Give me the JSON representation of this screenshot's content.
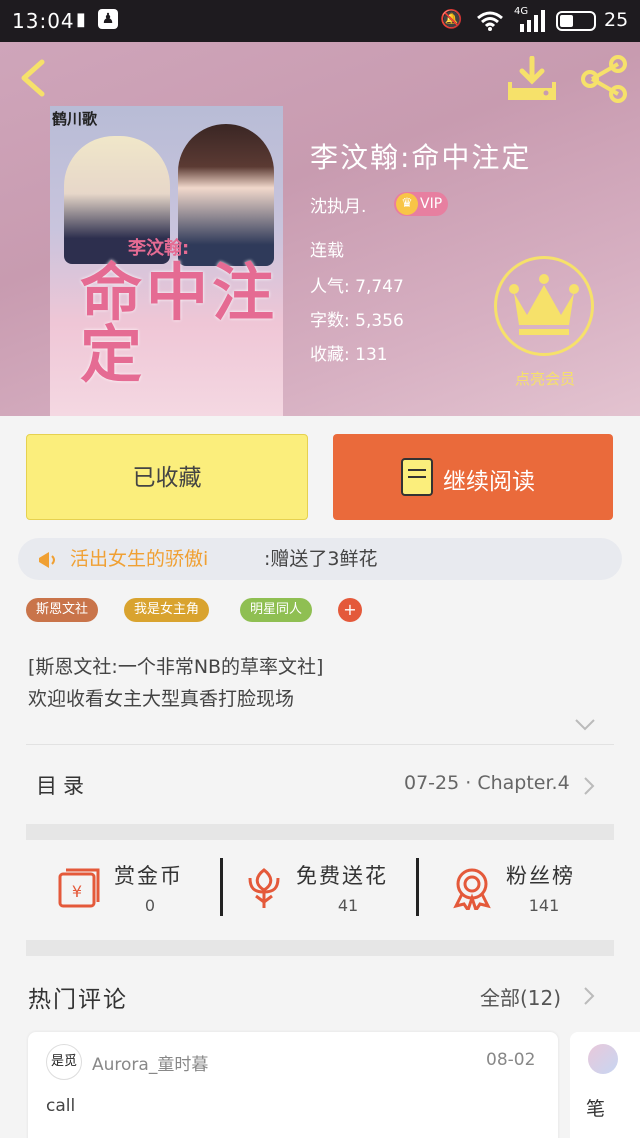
{
  "status_bar": {
    "time": "13:04",
    "network": "4G",
    "battery": "25"
  },
  "book": {
    "title": "李汶翰:命中注定",
    "author": "沈执月.",
    "vip_badge": "VIP",
    "status": "连载",
    "popularity": "人气: 7,747",
    "word_count": "字数: 5,356",
    "favorites": "收藏: 131",
    "cover_mark": "鹤川歌",
    "cover_title_sub": "李汶翰:",
    "cover_title": "命中注定"
  },
  "vip": {
    "label": "点亮会员"
  },
  "actions": {
    "favorited_label": "已收藏",
    "read_label": "继续阅读"
  },
  "gift": {
    "sender": "活出女生的骄傲i",
    "text": ":赠送了3鲜花"
  },
  "tags": [
    {
      "label": "斯恩文社",
      "color": "#c9744a"
    },
    {
      "label": "我是女主角",
      "color": "#d9a32f"
    },
    {
      "label": "明星同人",
      "color": "#8fbf52"
    }
  ],
  "tag_add": "+",
  "description": {
    "line1": "[斯恩文社:一个非常NB的草率文社]",
    "line2": "欢迎收看女主大型真香打脸现场"
  },
  "toc": {
    "label": "目录",
    "latest": "07-25 · Chapter.4"
  },
  "stats": [
    {
      "label": "赏金币",
      "value": "0"
    },
    {
      "label": "免费送花",
      "value": "41"
    },
    {
      "label": "粉丝榜",
      "value": "141"
    }
  ],
  "comments": {
    "title": "热门评论",
    "all_label": "全部(12)",
    "items": [
      {
        "avatar_text": "是觅",
        "user": "Aurora_童时暮",
        "date": "08-02",
        "text": "call"
      },
      {
        "text": "笔"
      }
    ]
  },
  "colors": {
    "accent_orange": "#ea6a3b",
    "accent_yellow": "#fbee7c",
    "vip_gold": "#f6e16a"
  }
}
